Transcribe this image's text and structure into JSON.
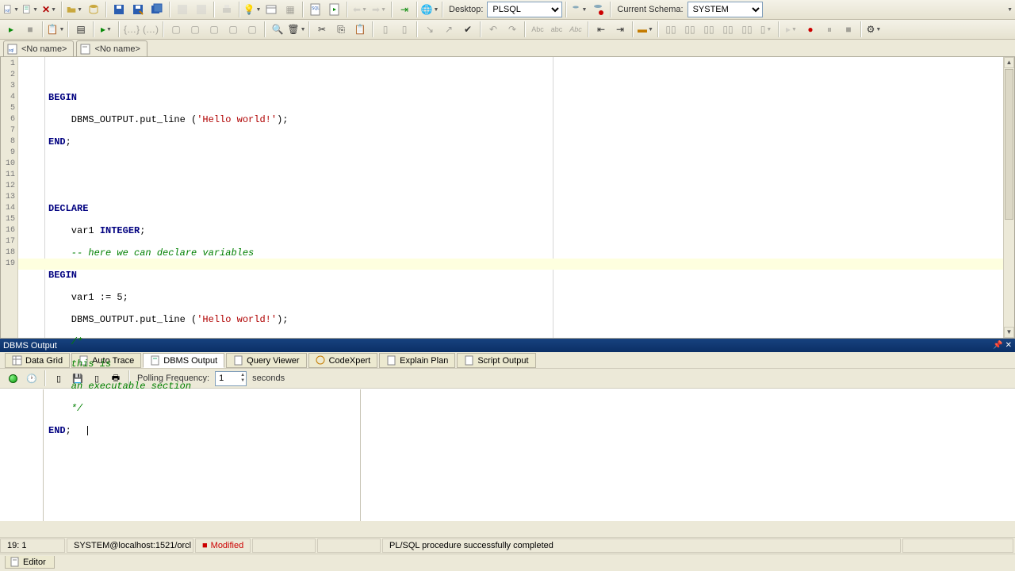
{
  "toolbar1": {
    "desktop_label": "Desktop:",
    "lang": "PLSQL",
    "schema_label": "Current Schema:",
    "schema": "SYSTEM"
  },
  "file_tabs": [
    {
      "label": "<No name>"
    },
    {
      "label": "<No name>"
    }
  ],
  "gutter_lines": [
    "1",
    "2",
    "3",
    "4",
    "5",
    "6",
    "7",
    "8",
    "9",
    "10",
    "11",
    "12",
    "13",
    "14",
    "15",
    "16",
    "17",
    "18",
    "19"
  ],
  "code": {
    "l2_a": "BEGIN",
    "l3_a": "    DBMS_OUTPUT.put_line (",
    "l3_s": "'Hello world!'",
    "l3_b": ");",
    "l4_a": "END",
    "l4_b": ";",
    "l7_a": "DECLARE",
    "l8_a": "    var1 ",
    "l8_k": "INTEGER",
    "l8_b": ";",
    "l9_c": "    -- here we can declare variables",
    "l10_a": "BEGIN",
    "l11_a": "    var1 := 5;",
    "l12_a": "    DBMS_OUTPUT.put_line (",
    "l12_s": "'Hello world!'",
    "l12_b": ");",
    "l13_c": "    /*",
    "l14_c": "    this is",
    "l15_c": "    an executable section",
    "l16_c": "    */",
    "l17_a": "END",
    "l17_b": ";"
  },
  "panel_title": "DBMS Output",
  "bottom_tabs": {
    "data_grid": "Data Grid",
    "auto_trace": "Auto Trace",
    "dbms_output": "DBMS Output",
    "query_viewer": "Query Viewer",
    "codexpert": "CodeXpert",
    "explain_plan": "Explain Plan",
    "script_output": "Script Output"
  },
  "dbms_toolbar": {
    "polling_label": "Polling Frequency:",
    "poll_value": "1",
    "seconds": "seconds"
  },
  "status": {
    "pos": "19: 1",
    "conn": "SYSTEM@localhost:1521/orcl",
    "modified": "Modified",
    "msg": "PL/SQL procedure successfully completed"
  },
  "editor_tab": "Editor"
}
